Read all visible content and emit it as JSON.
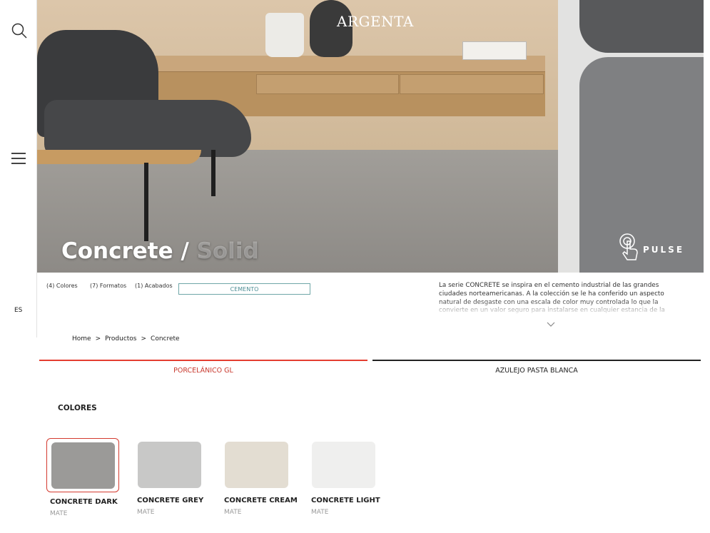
{
  "sidebar": {
    "language": "ES"
  },
  "hero": {
    "brand": "ARGENTA",
    "title_main": "Concrete /",
    "title_sub": "Solid",
    "pulse_label": "PULSE"
  },
  "tabs": {
    "colores": "(4) Colores",
    "formatos": "(7) Formatos",
    "acabados": "(1) Acabados",
    "category": "CEMENTO"
  },
  "description": "La serie CONCRETE se inspira en el cemento industrial de las grandes ciudades norteamericanas. A la colección se le ha conferido un aspecto natural de desgaste con una escala de color muy controlada lo que la convierte en un valor seguro para instalarse en cualquier estancia de la vivienda o proyecto, tanto en interiores como",
  "breadcrumb": [
    "Home",
    "Productos",
    "Concrete"
  ],
  "breadcrumb_sep": ">",
  "type_tabs": [
    {
      "label": "PORCELÁNICO GL",
      "active": true
    },
    {
      "label": "AZULEJO PASTA BLANCA",
      "active": false
    }
  ],
  "colors_heading": "COLORES",
  "colors": [
    {
      "name": "CONCRETE DARK",
      "finish": "MATE",
      "swatch": "#9b9a98",
      "selected": true
    },
    {
      "name": "CONCRETE GREY",
      "finish": "MATE",
      "swatch": "#c8c8c7",
      "selected": false
    },
    {
      "name": "CONCRETE CREAM",
      "finish": "MATE",
      "swatch": "#e3ddd2",
      "selected": false
    },
    {
      "name": "CONCRETE LIGHT",
      "finish": "MATE",
      "swatch": "#efefee",
      "selected": false
    }
  ],
  "accent_color": "#e43d30",
  "teal_color": "#4f8f96"
}
